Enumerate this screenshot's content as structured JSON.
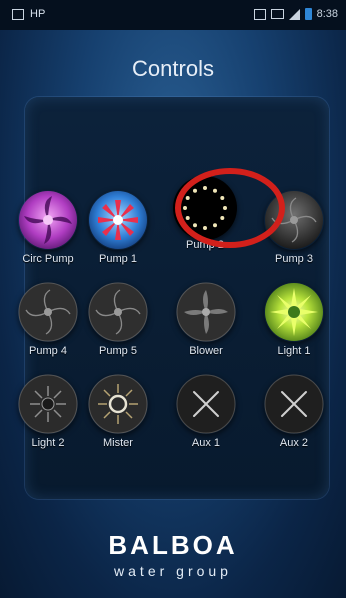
{
  "status_bar": {
    "left_text": "HP",
    "time": "8:38",
    "icons": [
      "picture-icon",
      "vibrate-icon",
      "wifi-icon",
      "signal-icon",
      "battery-icon"
    ]
  },
  "title": "Controls",
  "controls": [
    {
      "label": "Circ Pump",
      "icon": "circ-pump-icon",
      "state": "on",
      "color": "#b040c0"
    },
    {
      "label": "Pump 1",
      "icon": "pump-icon",
      "state": "on",
      "color": "#e0304a"
    },
    {
      "label": "Pump 2",
      "icon": "pump-dots-icon",
      "state": "highlighted",
      "color": "#000000"
    },
    {
      "label": "Pump 3",
      "icon": "pump-icon",
      "state": "off",
      "color": "#3a3a3a"
    },
    {
      "label": "Pump 4",
      "icon": "pump-icon",
      "state": "off",
      "color": "#3a3a3a"
    },
    {
      "label": "Pump 5",
      "icon": "pump-icon",
      "state": "off",
      "color": "#3a3a3a"
    },
    {
      "label": "Blower",
      "icon": "blower-icon",
      "state": "off",
      "color": "#3a3a3a"
    },
    {
      "label": "Light 1",
      "icon": "light-icon",
      "state": "on",
      "color": "#9ed23a"
    },
    {
      "label": "Light 2",
      "icon": "light-icon",
      "state": "off",
      "color": "#3a3a3a"
    },
    {
      "label": "Mister",
      "icon": "mister-icon",
      "state": "off",
      "color": "#3a3a3a"
    },
    {
      "label": "Aux 1",
      "icon": "aux-icon",
      "state": "off",
      "color": "#2a2a2a"
    },
    {
      "label": "Aux 2",
      "icon": "aux-icon",
      "state": "off",
      "color": "#2a2a2a"
    }
  ],
  "logo": {
    "brand": "BALBOA",
    "tagline": "water group"
  },
  "colors": {
    "highlight_ring": "#d2201b",
    "background": "#16406f"
  }
}
